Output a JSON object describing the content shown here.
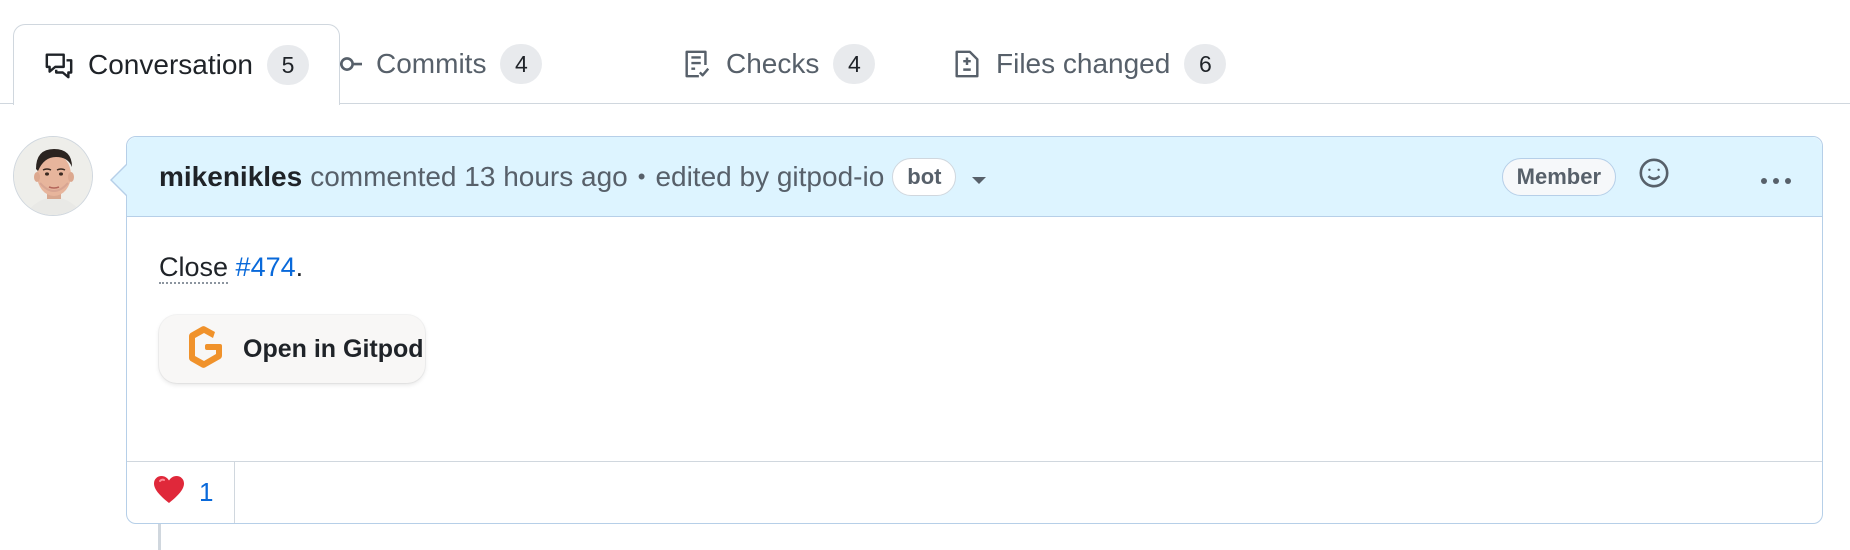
{
  "tabs": [
    {
      "label": "Conversation",
      "count": "5",
      "icon": "comment-discussion-icon",
      "active": true
    },
    {
      "label": "Commits",
      "count": "4",
      "icon": "commit-icon",
      "active": false
    },
    {
      "label": "Checks",
      "count": "4",
      "icon": "checklist-icon",
      "active": false
    },
    {
      "label": "Files changed",
      "count": "6",
      "icon": "file-diff-icon",
      "active": false
    }
  ],
  "comment": {
    "author": "mikenikles",
    "action": "commented 13 hours ago",
    "separator": "•",
    "edited_by": "edited by gitpod-io",
    "bot_badge": "bot",
    "role_badge": "Member",
    "body": {
      "close_word": "Close",
      "issue_ref": "#474",
      "trailing": "."
    },
    "gitpod_button": "Open in Gitpod",
    "reactions": [
      {
        "emoji": "❤️",
        "count": "1"
      }
    ]
  },
  "colors": {
    "header_bg": "#ddf4ff",
    "link": "#0969da",
    "gitpod_orange": "#f0922b"
  }
}
